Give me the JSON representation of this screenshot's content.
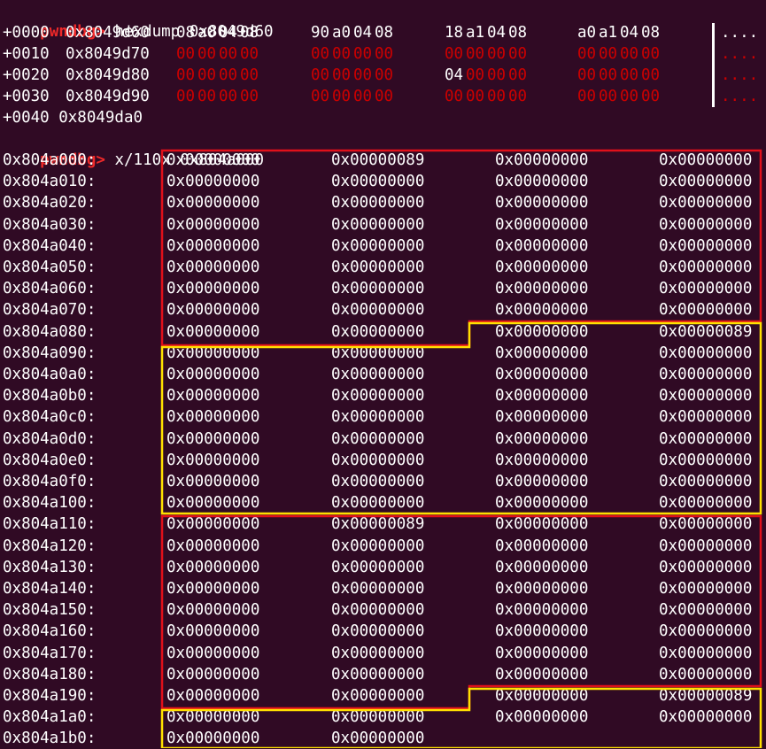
{
  "prompt": "pwndbg>",
  "cmd1": " hexdump 0x8049d60",
  "hexdump": [
    {
      "offset": "+0000",
      "addr": "0x8049d60",
      "bytes": [
        [
          "08",
          "a0",
          "04",
          "08"
        ],
        [
          "90",
          "a0",
          "04",
          "08"
        ],
        [
          "18",
          "a1",
          "04",
          "08"
        ],
        [
          "a0",
          "a1",
          "04",
          "08"
        ]
      ],
      "zero_mask": [
        [
          0,
          0,
          0,
          0
        ],
        [
          0,
          0,
          0,
          0
        ],
        [
          0,
          0,
          0,
          0
        ],
        [
          0,
          0,
          0,
          0
        ]
      ],
      "ascii": "....",
      "ascii_color": "#ffffff"
    },
    {
      "offset": "+0010",
      "addr": "0x8049d70",
      "bytes": [
        [
          "00",
          "00",
          "00",
          "00"
        ],
        [
          "00",
          "00",
          "00",
          "00"
        ],
        [
          "00",
          "00",
          "00",
          "00"
        ],
        [
          "00",
          "00",
          "00",
          "00"
        ]
      ],
      "zero_mask": [
        [
          1,
          1,
          1,
          1
        ],
        [
          1,
          1,
          1,
          1
        ],
        [
          1,
          1,
          1,
          1
        ],
        [
          1,
          1,
          1,
          1
        ]
      ],
      "ascii": "....",
      "ascii_color": "#cc0000"
    },
    {
      "offset": "+0020",
      "addr": "0x8049d80",
      "bytes": [
        [
          "00",
          "00",
          "00",
          "00"
        ],
        [
          "00",
          "00",
          "00",
          "00"
        ],
        [
          "04",
          "00",
          "00",
          "00"
        ],
        [
          "00",
          "00",
          "00",
          "00"
        ]
      ],
      "zero_mask": [
        [
          1,
          1,
          1,
          1
        ],
        [
          1,
          1,
          1,
          1
        ],
        [
          0,
          1,
          1,
          1
        ],
        [
          1,
          1,
          1,
          1
        ]
      ],
      "ascii": "....",
      "ascii_color": "#cc0000"
    },
    {
      "offset": "+0030",
      "addr": "0x8049d90",
      "bytes": [
        [
          "00",
          "00",
          "00",
          "00"
        ],
        [
          "00",
          "00",
          "00",
          "00"
        ],
        [
          "00",
          "00",
          "00",
          "00"
        ],
        [
          "00",
          "00",
          "00",
          "00"
        ]
      ],
      "zero_mask": [
        [
          1,
          1,
          1,
          1
        ],
        [
          1,
          1,
          1,
          1
        ],
        [
          1,
          1,
          1,
          1
        ],
        [
          1,
          1,
          1,
          1
        ]
      ],
      "ascii": "....",
      "ascii_color": "#cc0000"
    }
  ],
  "hexdump_end": "+0040 0x8049da0",
  "cmd2": " x/110x 0x804a000",
  "memory": [
    {
      "addr": "0x804a000:",
      "words": [
        "0x00000000",
        "0x00000089",
        "0x00000000",
        "0x00000000"
      ]
    },
    {
      "addr": "0x804a010:",
      "words": [
        "0x00000000",
        "0x00000000",
        "0x00000000",
        "0x00000000"
      ]
    },
    {
      "addr": "0x804a020:",
      "words": [
        "0x00000000",
        "0x00000000",
        "0x00000000",
        "0x00000000"
      ]
    },
    {
      "addr": "0x804a030:",
      "words": [
        "0x00000000",
        "0x00000000",
        "0x00000000",
        "0x00000000"
      ]
    },
    {
      "addr": "0x804a040:",
      "words": [
        "0x00000000",
        "0x00000000",
        "0x00000000",
        "0x00000000"
      ]
    },
    {
      "addr": "0x804a050:",
      "words": [
        "0x00000000",
        "0x00000000",
        "0x00000000",
        "0x00000000"
      ]
    },
    {
      "addr": "0x804a060:",
      "words": [
        "0x00000000",
        "0x00000000",
        "0x00000000",
        "0x00000000"
      ]
    },
    {
      "addr": "0x804a070:",
      "words": [
        "0x00000000",
        "0x00000000",
        "0x00000000",
        "0x00000000"
      ]
    },
    {
      "addr": "0x804a080:",
      "words": [
        "0x00000000",
        "0x00000000",
        "0x00000000",
        "0x00000089"
      ]
    },
    {
      "addr": "0x804a090:",
      "words": [
        "0x00000000",
        "0x00000000",
        "0x00000000",
        "0x00000000"
      ]
    },
    {
      "addr": "0x804a0a0:",
      "words": [
        "0x00000000",
        "0x00000000",
        "0x00000000",
        "0x00000000"
      ]
    },
    {
      "addr": "0x804a0b0:",
      "words": [
        "0x00000000",
        "0x00000000",
        "0x00000000",
        "0x00000000"
      ]
    },
    {
      "addr": "0x804a0c0:",
      "words": [
        "0x00000000",
        "0x00000000",
        "0x00000000",
        "0x00000000"
      ]
    },
    {
      "addr": "0x804a0d0:",
      "words": [
        "0x00000000",
        "0x00000000",
        "0x00000000",
        "0x00000000"
      ]
    },
    {
      "addr": "0x804a0e0:",
      "words": [
        "0x00000000",
        "0x00000000",
        "0x00000000",
        "0x00000000"
      ]
    },
    {
      "addr": "0x804a0f0:",
      "words": [
        "0x00000000",
        "0x00000000",
        "0x00000000",
        "0x00000000"
      ]
    },
    {
      "addr": "0x804a100:",
      "words": [
        "0x00000000",
        "0x00000000",
        "0x00000000",
        "0x00000000"
      ]
    },
    {
      "addr": "0x804a110:",
      "words": [
        "0x00000000",
        "0x00000089",
        "0x00000000",
        "0x00000000"
      ]
    },
    {
      "addr": "0x804a120:",
      "words": [
        "0x00000000",
        "0x00000000",
        "0x00000000",
        "0x00000000"
      ]
    },
    {
      "addr": "0x804a130:",
      "words": [
        "0x00000000",
        "0x00000000",
        "0x00000000",
        "0x00000000"
      ]
    },
    {
      "addr": "0x804a140:",
      "words": [
        "0x00000000",
        "0x00000000",
        "0x00000000",
        "0x00000000"
      ]
    },
    {
      "addr": "0x804a150:",
      "words": [
        "0x00000000",
        "0x00000000",
        "0x00000000",
        "0x00000000"
      ]
    },
    {
      "addr": "0x804a160:",
      "words": [
        "0x00000000",
        "0x00000000",
        "0x00000000",
        "0x00000000"
      ]
    },
    {
      "addr": "0x804a170:",
      "words": [
        "0x00000000",
        "0x00000000",
        "0x00000000",
        "0x00000000"
      ]
    },
    {
      "addr": "0x804a180:",
      "words": [
        "0x00000000",
        "0x00000000",
        "0x00000000",
        "0x00000000"
      ]
    },
    {
      "addr": "0x804a190:",
      "words": [
        "0x00000000",
        "0x00000000",
        "0x00000000",
        "0x00000089"
      ]
    },
    {
      "addr": "0x804a1a0:",
      "words": [
        "0x00000000",
        "0x00000000",
        "0x00000000",
        "0x00000000"
      ]
    },
    {
      "addr": "0x804a1b0:",
      "words": [
        "0x00000000",
        "0x00000000"
      ]
    }
  ],
  "colors": {
    "background": "#300a24",
    "prompt": "#ef2929",
    "zero_byte": "#cc0000",
    "text": "#ffffff",
    "chunk_box_red": "#e0101a",
    "chunk_box_yellow": "#ffe100"
  }
}
